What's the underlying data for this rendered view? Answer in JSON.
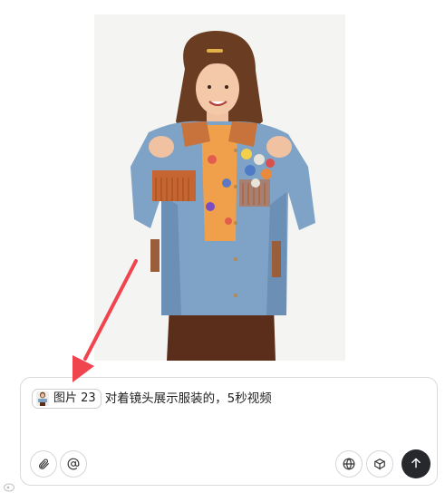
{
  "composer": {
    "reference_chip": {
      "label": "图片 23"
    },
    "prompt": "对着镜头展示服装的，5秒视频"
  },
  "toolbar_icons": {
    "attach": "paperclip-icon",
    "mention": "at-sign-icon",
    "web": "globe-icon",
    "model": "cube-icon",
    "send": "arrow-up-icon"
  },
  "annotation": {
    "arrow_color": "#f0444f"
  },
  "colors": {
    "send_button": "#27282c",
    "border": "#d9d9de"
  }
}
